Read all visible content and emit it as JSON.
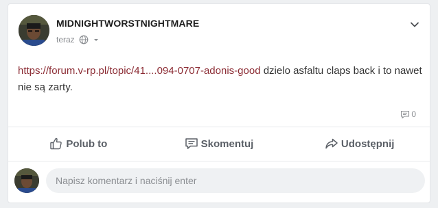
{
  "post": {
    "author": "MIDNIGHTWORSTNIGHTMARE",
    "timestamp": "teraz",
    "privacy_icon": "globe-icon",
    "link_text": "https://forum.v-rp.pl/topic/41....094-0707-adonis-good",
    "body_text": " dzielo asfaltu claps back i to nawet nie są zarty.",
    "comment_count": "0"
  },
  "actions": {
    "like_label": "Polub to",
    "comment_label": "Skomentuj",
    "share_label": "Udostępnij"
  },
  "comment_box": {
    "placeholder": "Napisz komentarz i naciśnij enter",
    "value": ""
  },
  "colors": {
    "link": "#8b2b33",
    "background": "#eef0f2",
    "card": "#ffffff",
    "muted": "#8a8d91"
  }
}
